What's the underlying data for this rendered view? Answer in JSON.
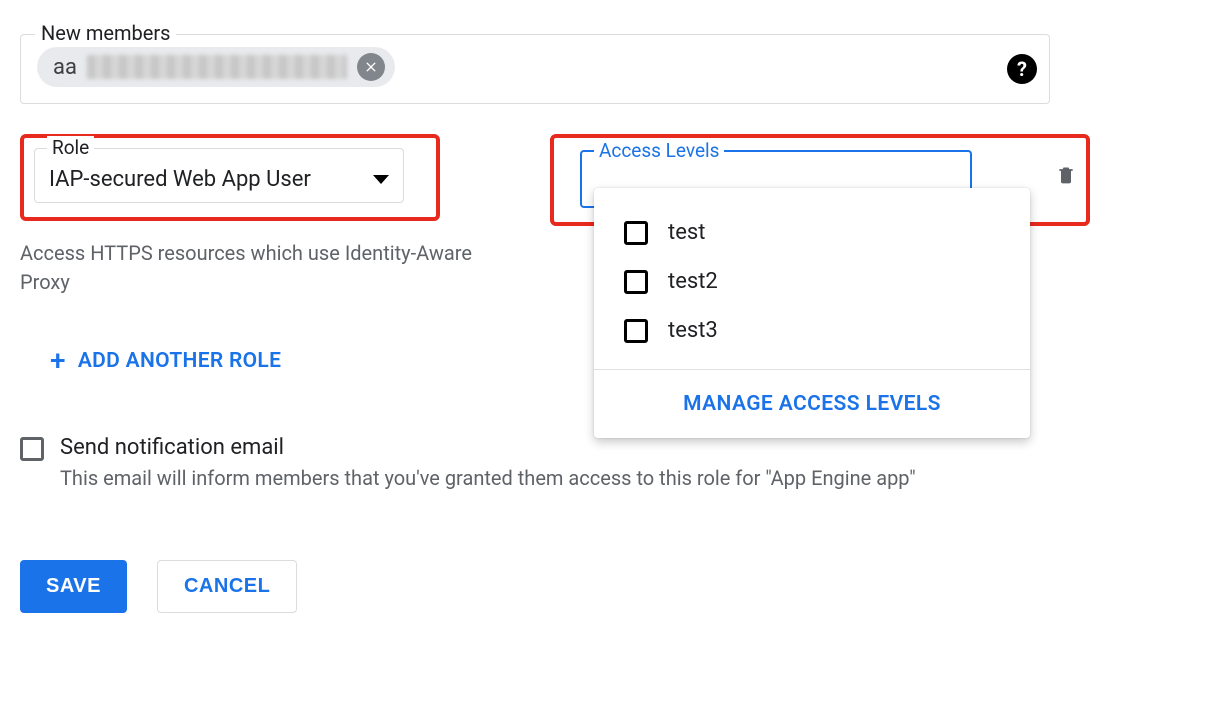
{
  "members": {
    "legend": "New members",
    "chip_prefix": "aa"
  },
  "role": {
    "label": "Role",
    "selected": "IAP-secured Web App User",
    "description": "Access HTTPS resources which use Identity-Aware Proxy"
  },
  "add_role_label": "ADD ANOTHER ROLE",
  "access_levels": {
    "label": "Access Levels",
    "options": [
      {
        "label": "test"
      },
      {
        "label": "test2"
      },
      {
        "label": "test3"
      }
    ],
    "manage_label": "MANAGE ACCESS LEVELS"
  },
  "notification": {
    "checkbox_label": "Send notification email",
    "description": "This email will inform members that you've granted them access to this role for \"App Engine app\""
  },
  "buttons": {
    "save": "SAVE",
    "cancel": "CANCEL"
  }
}
